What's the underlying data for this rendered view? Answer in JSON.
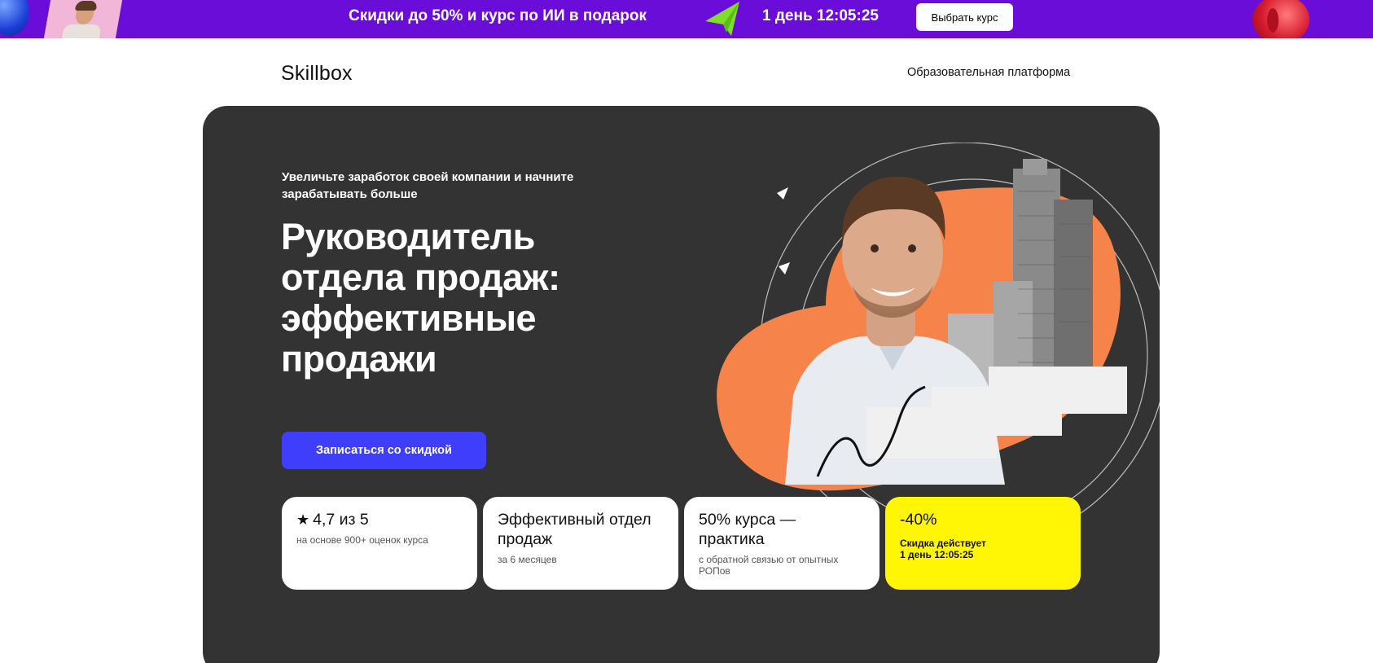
{
  "promo": {
    "text": "Скидки до 50% и курс по ИИ в подарок",
    "timer": "1 день 12:05:25",
    "button": "Выбрать курс"
  },
  "header": {
    "logo": "Skillbox",
    "nav_link": "Образовательная платформа"
  },
  "hero": {
    "subtitle": "Увеличьте заработок своей компании и начните зарабатывать больше",
    "title": "Руководитель отдела продаж: эффективные продажи",
    "cta": "Записаться со скидкой"
  },
  "cards": [
    {
      "title": "4,7 из 5",
      "subtitle": "на основе 900+ оценок курса",
      "icon": "star-icon"
    },
    {
      "title": "Эффективный отдел продаж",
      "subtitle": "за 6 месяцев"
    },
    {
      "title": "50% курса — практика",
      "subtitle": "с обратной связью от опытных РОПов"
    },
    {
      "title": "-40%",
      "subtitle_line1": "Скидка  действует",
      "subtitle_line2": "1 день 12:05:25"
    }
  ],
  "colors": {
    "promo_bg": "#6a0dd8",
    "hero_bg": "#333333",
    "cta_bg": "#3e3efb",
    "accent_orange": "#f5834a",
    "discount_card": "#fef605"
  }
}
